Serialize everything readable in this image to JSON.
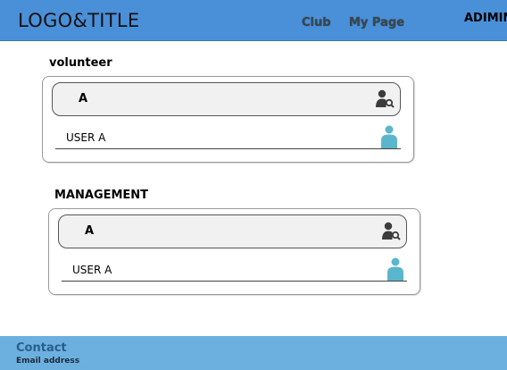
{
  "header": {
    "logo": "LOGO&TITLE",
    "nav": {
      "club": "Club",
      "mypage": "My Page"
    },
    "admin": "ADIMIN"
  },
  "sections": [
    {
      "title": "volunteer",
      "search_value": "A",
      "user_label": "USER A"
    },
    {
      "title": "MANAGEMENT",
      "search_value": "A",
      "user_label": "USER A"
    }
  ],
  "footer": {
    "contact": "Contact",
    "email": "Email address"
  },
  "colors": {
    "header": "#4a90d9",
    "footer": "#6cb0e0",
    "user_icon": "#5ab6cc",
    "search_icon": "#3c3c3c"
  }
}
